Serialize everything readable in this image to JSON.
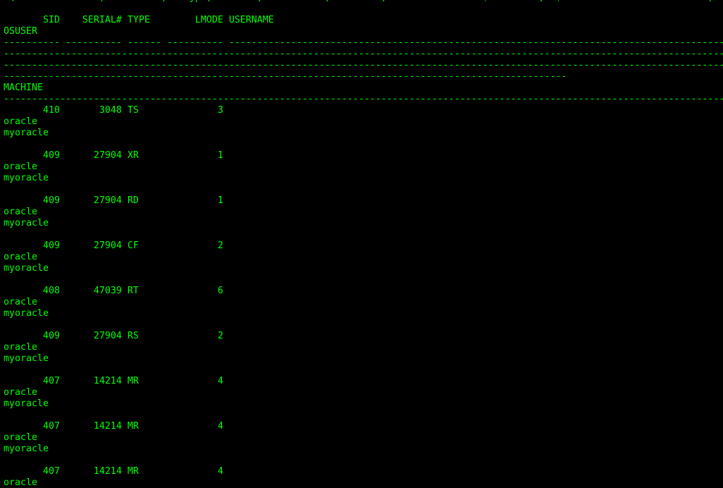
{
  "terminal": {
    "foreground": "#00ff00",
    "background": "#000000",
    "lines": [
      "SQL> SELECT s.sid, s.serial#, l.type, l.lmode, s.username, s.osuser, s.machine FROM v$session s, v$lock l WHERE s.sid = l.sid;",
      "",
      "       SID    SERIAL# TYPE        LMODE USERNAME",
      "OSUSER",
      "---------- ---------- ------ ---------- --------------------------------------------------------------------------------------------------------------------------------",
      "--------------------------------------------------------------------------------------------------------------------------------",
      "--------------------------------------------------------------------------------------------------------------------------------",
      "----------------------------------------------------------------------------------------------------",
      "MACHINE",
      "--------------------------------------------------------------------------------------------------------------------------------",
      "       410       3048 TS              3",
      "oracle",
      "myoracle",
      "",
      "       409      27904 XR              1",
      "oracle",
      "myoracle",
      "",
      "       409      27904 RD              1",
      "oracle",
      "myoracle",
      "",
      "       409      27904 CF              2",
      "oracle",
      "myoracle",
      "",
      "       408      47039 RT              6",
      "oracle",
      "myoracle",
      "",
      "       409      27904 RS              2",
      "oracle",
      "myoracle",
      "",
      "       407      14214 MR              4",
      "oracle",
      "myoracle",
      "",
      "       407      14214 MR              4",
      "oracle",
      "myoracle",
      "",
      "       407      14214 MR              4",
      "oracle"
    ]
  }
}
